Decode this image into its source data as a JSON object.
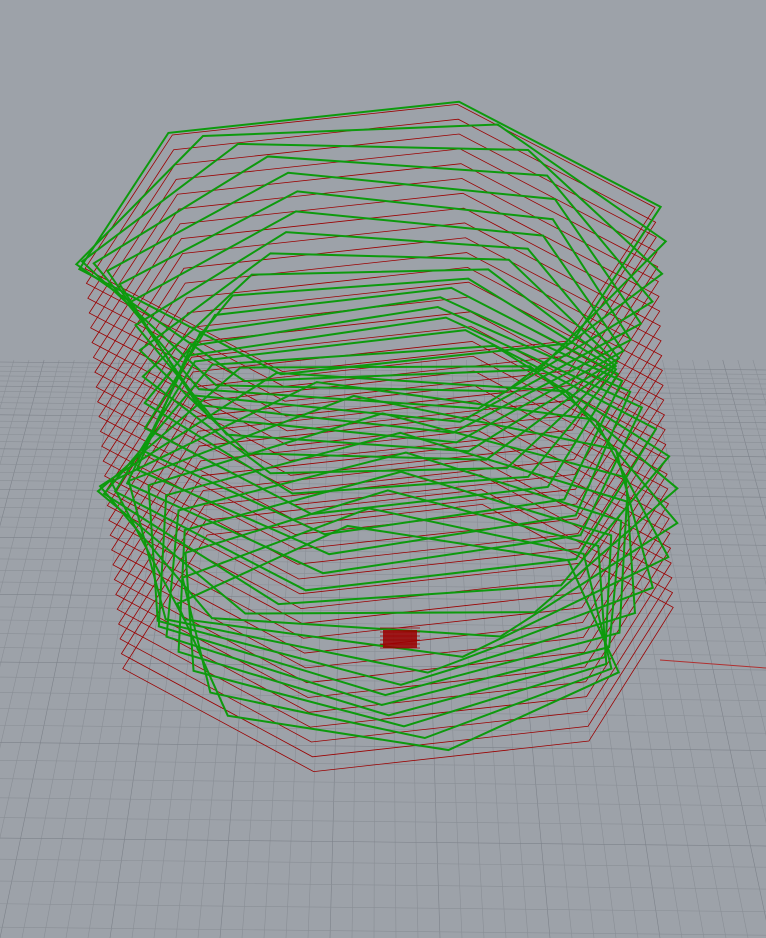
{
  "viewport": {
    "background_color": "#9da2a9",
    "grid_color": "#8a8f96",
    "grid_major_color": "#7d828a",
    "x_axis_color": "#b03030"
  },
  "model": {
    "red_polygon_color": "#9b0000",
    "green_polygon_color": "#0d9a0d",
    "layer_count": 28,
    "polygon_sides": 6,
    "twist_degrees_total": 60
  }
}
